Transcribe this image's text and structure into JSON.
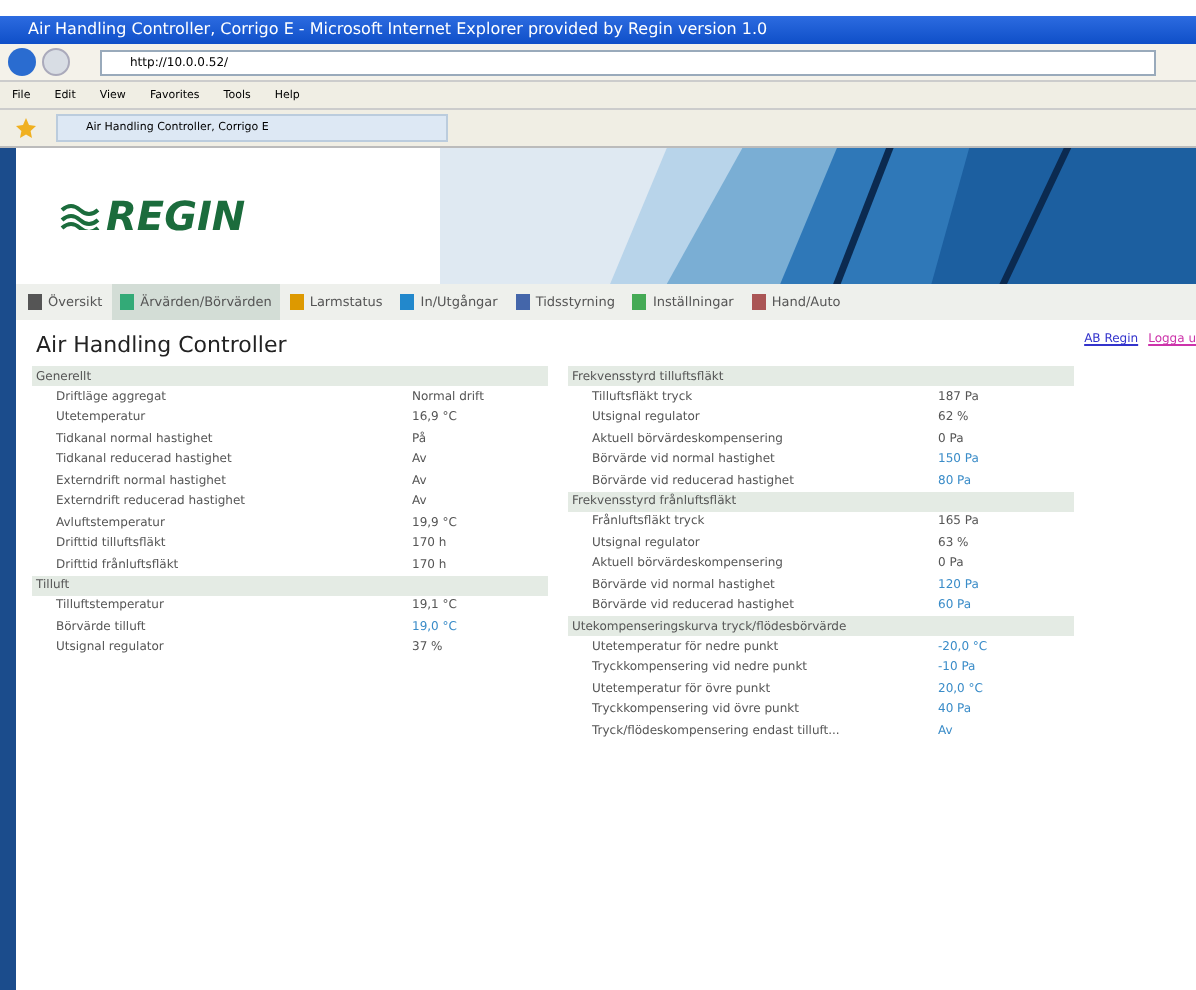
{
  "window": {
    "title": "Air Handling Controller, Corrigo E - Microsoft Internet Explorer provided by Regin version 1.0"
  },
  "address": {
    "value": "http://10.0.0.52/"
  },
  "menu": [
    "File",
    "Edit",
    "View",
    "Favorites",
    "Tools",
    "Help"
  ],
  "browser_tab": {
    "label": "Air Handling Controller, Corrigo E"
  },
  "logo": {
    "text": "REGIN"
  },
  "nav_tabs": [
    {
      "label": "Översikt",
      "selected": false
    },
    {
      "label": "Ärvärden/Börvärden",
      "selected": true
    },
    {
      "label": "Larmstatus",
      "selected": false
    },
    {
      "label": "In/Utgångar",
      "selected": false
    },
    {
      "label": "Tidsstyrning",
      "selected": false
    },
    {
      "label": "Inställningar",
      "selected": false
    },
    {
      "label": "Hand/Auto",
      "selected": false
    }
  ],
  "heading": "Air Handling Controller",
  "links": [
    "AB Regin",
    "Logga u"
  ],
  "left_table": [
    {
      "kind": "section",
      "label": "Generellt"
    },
    {
      "kind": "row",
      "label": "Driftläge aggregat",
      "value": "Normal drift",
      "editable": false
    },
    {
      "kind": "row",
      "label": "Utetemperatur",
      "value": "16,9 °C",
      "editable": false
    },
    {
      "kind": "row",
      "label": "Tidkanal normal hastighet",
      "value": "På",
      "editable": false
    },
    {
      "kind": "row",
      "label": "Tidkanal reducerad hastighet",
      "value": "Av",
      "editable": false
    },
    {
      "kind": "row",
      "label": "Externdrift normal hastighet",
      "value": "Av",
      "editable": false
    },
    {
      "kind": "row",
      "label": "Externdrift reducerad hastighet",
      "value": "Av",
      "editable": false
    },
    {
      "kind": "row",
      "label": "Avluftstemperatur",
      "value": "19,9 °C",
      "editable": false
    },
    {
      "kind": "row",
      "label": "Drifttid tilluftsfläkt",
      "value": "170 h",
      "editable": false
    },
    {
      "kind": "row",
      "label": "Drifttid frånluftsfläkt",
      "value": "170 h",
      "editable": false
    },
    {
      "kind": "section",
      "label": "Tilluft"
    },
    {
      "kind": "row",
      "label": "Tilluftstemperatur",
      "value": "19,1 °C",
      "editable": false
    },
    {
      "kind": "row",
      "label": "Börvärde tilluft",
      "value": "19,0 °C",
      "editable": true
    },
    {
      "kind": "row",
      "label": "Utsignal regulator",
      "value": "37 %",
      "editable": false
    }
  ],
  "right_table": [
    {
      "kind": "section",
      "label": "Frekvensstyrd tilluftsfläkt"
    },
    {
      "kind": "row",
      "label": "Tilluftsfläkt tryck",
      "value": "187 Pa",
      "editable": false
    },
    {
      "kind": "row",
      "label": "Utsignal regulator",
      "value": "62 %",
      "editable": false
    },
    {
      "kind": "row",
      "label": "Aktuell börvärdeskompensering",
      "value": "0 Pa",
      "editable": false
    },
    {
      "kind": "row",
      "label": "Börvärde vid normal hastighet",
      "value": "150 Pa",
      "editable": true
    },
    {
      "kind": "row",
      "label": "Börvärde vid reducerad hastighet",
      "value": "80 Pa",
      "editable": true
    },
    {
      "kind": "section",
      "label": "Frekvensstyrd frånluftsfläkt"
    },
    {
      "kind": "row",
      "label": "Frånluftsfläkt tryck",
      "value": "165 Pa",
      "editable": false
    },
    {
      "kind": "row",
      "label": "Utsignal regulator",
      "value": "63 %",
      "editable": false
    },
    {
      "kind": "row",
      "label": "Aktuell börvärdeskompensering",
      "value": "0 Pa",
      "editable": false
    },
    {
      "kind": "row",
      "label": "Börvärde vid normal hastighet",
      "value": "120 Pa",
      "editable": true
    },
    {
      "kind": "row",
      "label": "Börvärde vid reducerad hastighet",
      "value": "60 Pa",
      "editable": true
    },
    {
      "kind": "section",
      "label": "Utekompenseringskurva tryck/flödesbörvärde"
    },
    {
      "kind": "row",
      "label": "Utetemperatur för nedre punkt",
      "value": "-20,0 °C",
      "editable": true
    },
    {
      "kind": "row",
      "label": "Tryckkompensering vid nedre punkt",
      "value": "-10 Pa",
      "editable": true
    },
    {
      "kind": "row",
      "label": "Utetemperatur för övre punkt",
      "value": "20,0 °C",
      "editable": true
    },
    {
      "kind": "row",
      "label": "Tryckkompensering vid övre punkt",
      "value": "40 Pa",
      "editable": true
    },
    {
      "kind": "row",
      "label": "Tryck/flödeskompensering endast tilluft...",
      "value": "Av",
      "editable": true
    }
  ]
}
